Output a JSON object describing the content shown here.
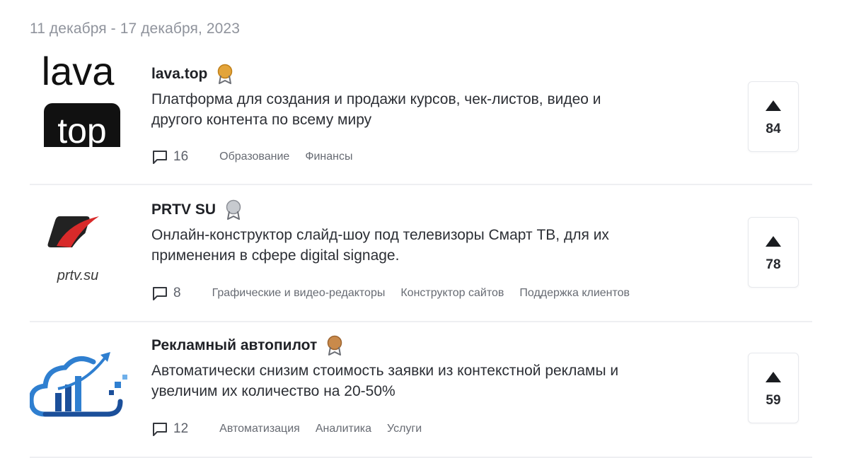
{
  "week_label": "11 декабря - 17 декабря, 2023",
  "products": [
    {
      "name": "lava.top",
      "medal_color": "#e3a43a",
      "description_line1": "Платформа для создания и продажи курсов, чек-листов, видео и",
      "description_line2": "другого контента по всему миру",
      "comments": "16",
      "tags": [
        "Образование",
        "Финансы"
      ],
      "votes": "84",
      "logo": {
        "line1": "lava",
        "line2": "top"
      }
    },
    {
      "name": "PRTV SU",
      "medal_color": "#a8acb3",
      "description_line1": "Онлайн-конструктор слайд-шоу под телевизоры Смарт ТВ, для их",
      "description_line2": "применения в сфере digital signage.",
      "comments": "8",
      "tags": [
        "Графические и видео-редакторы",
        "Конструктор сайтов",
        "Поддержка клиентов"
      ],
      "votes": "78",
      "logo": {
        "text": "prtv.su"
      }
    },
    {
      "name": "Рекламный автопилот",
      "medal_color": "#c98a4b",
      "description_line1": "Автоматически снизим стоимость заявки из контекстной рекламы и",
      "description_line2": "увеличим их количество на 20-50%",
      "comments": "12",
      "tags": [
        "Автоматизация",
        "Аналитика",
        "Услуги"
      ],
      "votes": "59"
    }
  ]
}
